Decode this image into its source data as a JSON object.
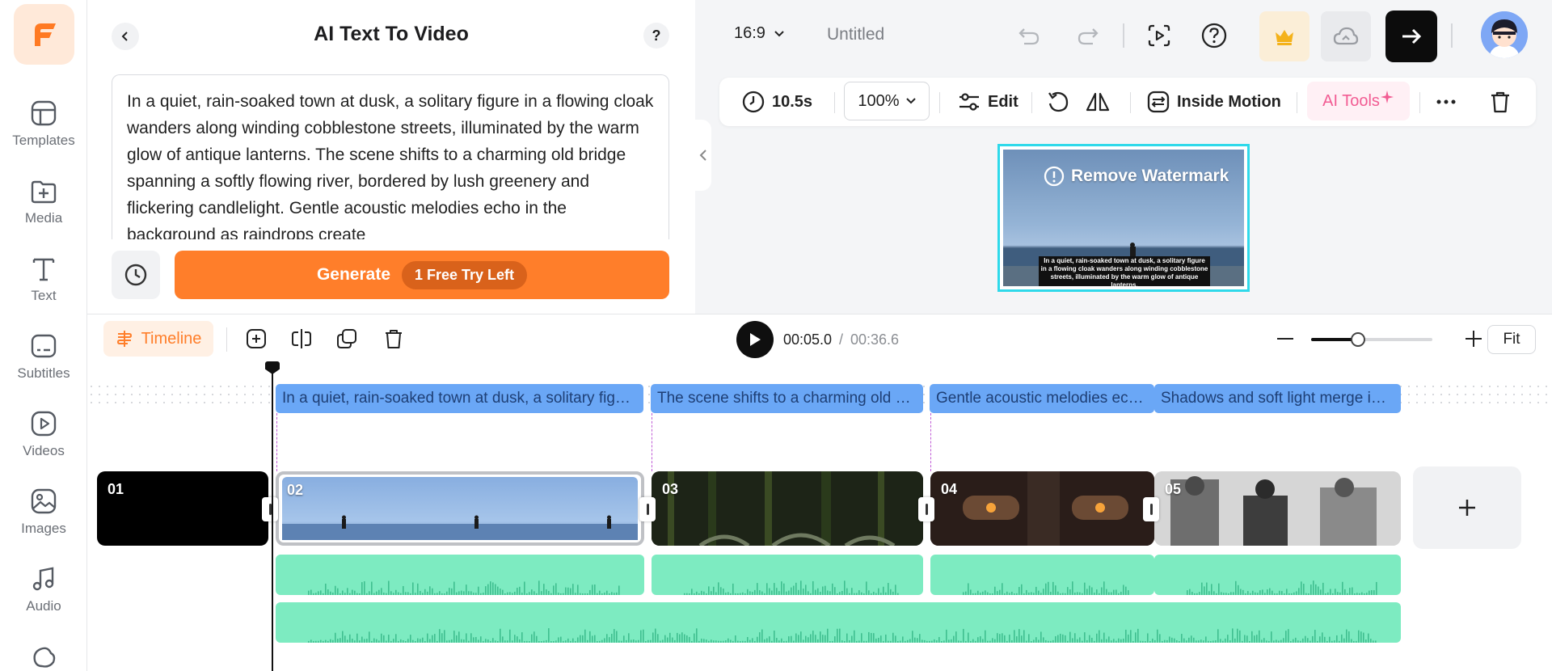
{
  "nav": {
    "items": [
      {
        "label": "Templates",
        "icon": "templates-icon"
      },
      {
        "label": "Media",
        "icon": "media-icon"
      },
      {
        "label": "Text",
        "icon": "text-icon"
      },
      {
        "label": "Subtitles",
        "icon": "subtitles-icon"
      },
      {
        "label": "Videos",
        "icon": "videos-icon"
      },
      {
        "label": "Images",
        "icon": "images-icon"
      },
      {
        "label": "Audio",
        "icon": "audio-icon"
      }
    ]
  },
  "panel": {
    "title": "AI Text To Video",
    "help": "?",
    "prompt": "In a quiet, rain-soaked town at dusk, a solitary figure in a flowing cloak wanders along winding cobblestone streets, illuminated by the warm glow of antique lanterns. The scene shifts to a charming old bridge spanning a softly flowing river, bordered by lush greenery and flickering candlelight. Gentle acoustic melodies echo in the background as raindrops create",
    "generate_label": "Generate",
    "free_try": "1 Free Try Left"
  },
  "topbar": {
    "ratio": "16:9",
    "project_name": "Untitled"
  },
  "toolbar": {
    "duration": "10.5s",
    "zoom": "100%",
    "edit": "Edit",
    "inside_motion": "Inside Motion",
    "ai_tools": "AI Tools"
  },
  "preview": {
    "watermark": "Remove Watermark",
    "caption": "In a quiet, rain-soaked town at dusk, a solitary figure in a flowing cloak wanders along winding cobblestone streets, illuminated by the warm glow of antique lanterns."
  },
  "timeline": {
    "label": "Timeline",
    "current_time": "00:05.0",
    "separator": "/",
    "total_time": "00:36.6",
    "fit": "Fit",
    "zoom_level": 0.38,
    "subtitles": [
      "In a quiet, rain-soaked town at dusk, a solitary figure in a flowing cloak wanders along winding cobblestone streets",
      "The scene shifts to a charming old bridge spanning a softly flowing river",
      "Gentle acoustic melodies echo in the background",
      "Shadows and soft light merge in the rain"
    ],
    "clips": [
      "01",
      "02",
      "03",
      "04",
      "05"
    ]
  },
  "colors": {
    "accent": "#ff7e2a",
    "subtitle_track": "#6aa7f6",
    "audio_track": "#7debc1",
    "selection": "#2fd9ea"
  }
}
